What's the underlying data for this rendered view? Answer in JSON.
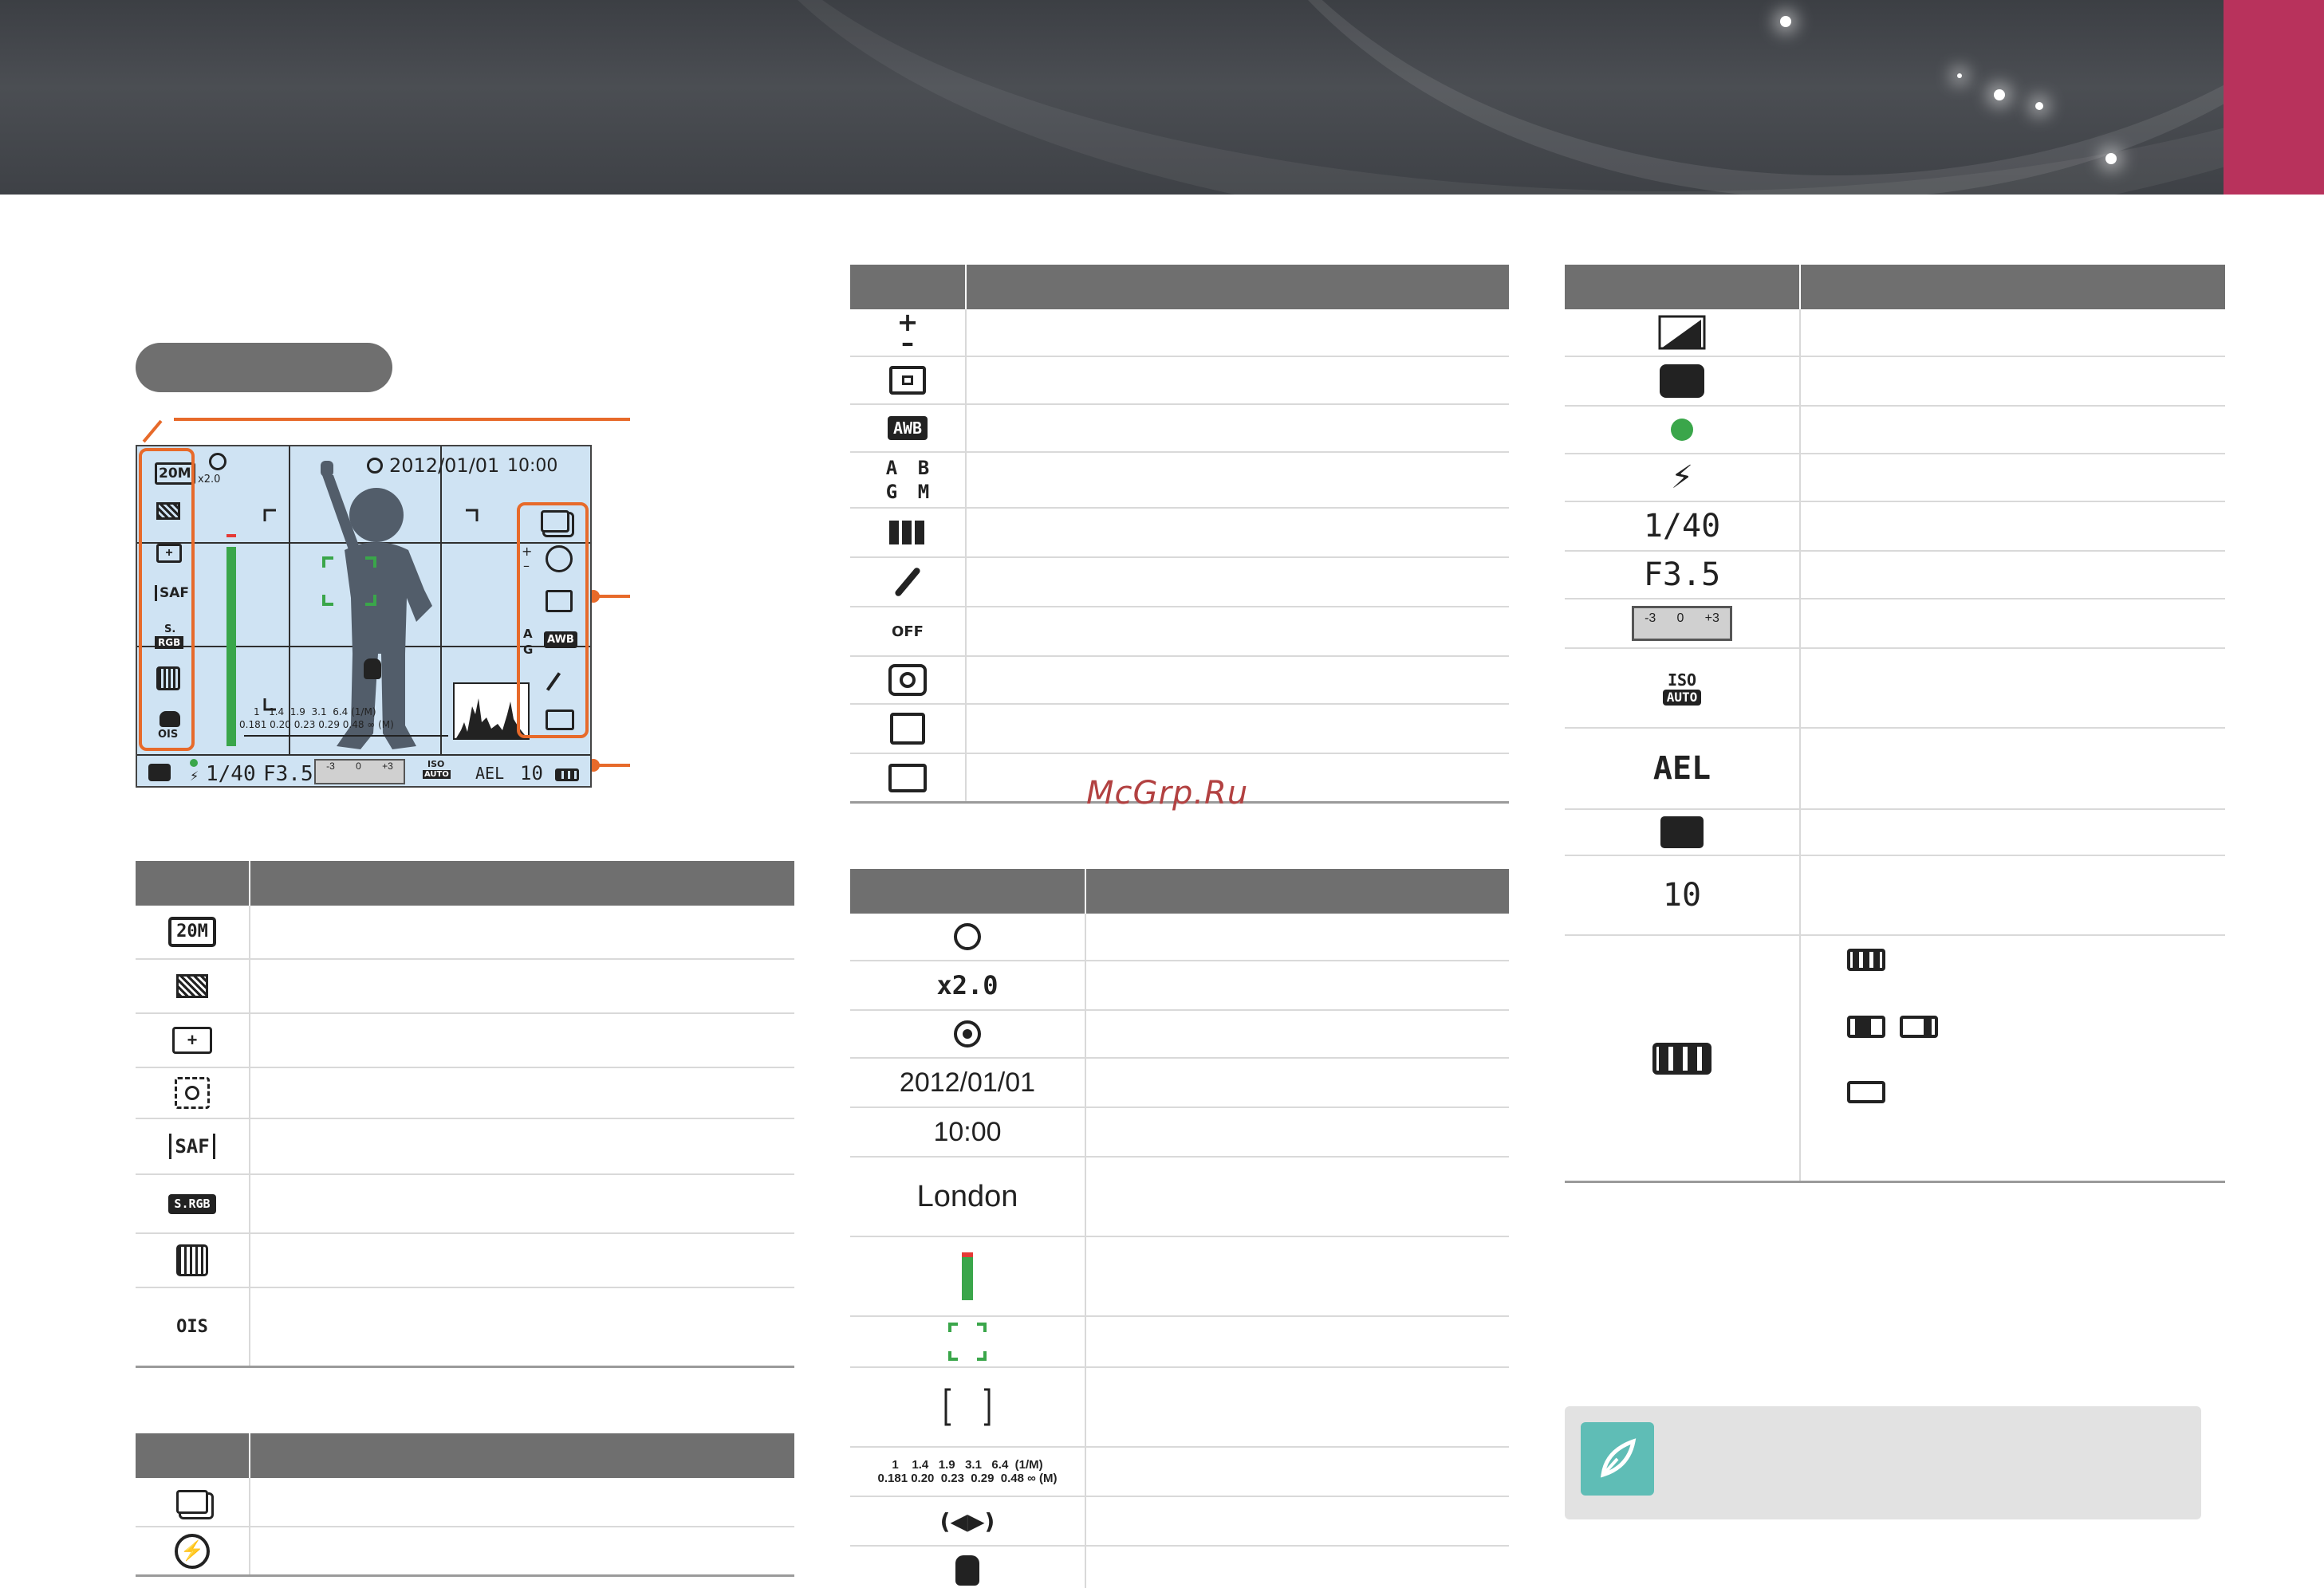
{
  "watermark": "McGrp.Ru",
  "table_left1": {
    "icons": [
      "20M",
      "quality-icon",
      "spot-af-icon",
      "face-af-icon",
      "SAF",
      "S.RGB",
      "smart-filter-off-icon",
      "OIS"
    ]
  },
  "table_left2": {
    "icons": [
      "drive-single-icon",
      "flash-off-icon"
    ]
  },
  "table_mid1": {
    "icons": [
      "exposure-comp-icon",
      "metering-icon",
      "AWB",
      "A B G M",
      "picture-wizard-icon",
      "smart-filter-icon",
      "color-off-icon",
      "iFunction-icon",
      "face-detect-icon",
      "smart-range-icon"
    ],
    "wb_shift": [
      "A",
      "B",
      "G",
      "M"
    ],
    "awb": "AWB",
    "color_off": "OFF"
  },
  "table_mid2": {
    "zoom": "x2.0",
    "date": "2012/01/01",
    "time": "10:00",
    "city": "London",
    "distance_top": "1    1.4   1.9   3.1   6.4  (1/M)",
    "distance_bottom": "0.181 0.20  0.23  0.29  0.48 ∞ (M)"
  },
  "table_right": {
    "shutter": "1/40",
    "aperture": "F3.5",
    "ev_scale": [
      "-3",
      "0",
      "+3"
    ],
    "iso_top": "ISO",
    "iso_bottom": "AUTO",
    "ael": "AEL",
    "shots": "10"
  },
  "screen": {
    "zoom_label": "x2.0",
    "date": "2012/01/01",
    "time": "10:00",
    "shutter": "1/40",
    "aperture": "F3.5",
    "ev": [
      "-3",
      "0",
      "+3"
    ],
    "iso_top": "ISO",
    "iso_bottom": "AUTO",
    "ael": "AEL",
    "shots": "10",
    "res": "20M",
    "saf": "SAF",
    "srgb_top": "S.",
    "srgb_bottom": "RGB",
    "ois": "OIS",
    "awb": "AWB",
    "wb_a": "A",
    "wb_g": "G",
    "dist_top": "1   1.4  1.9  3.1  6.4 (1/M)",
    "dist_bottom": "0.181 0.20 0.23 0.29 0.48 ∞ (M)"
  },
  "colors": {
    "header_gray": "#6f6f6f",
    "accent_pink": "#b8325c",
    "callout_orange": "#e76a2a",
    "focus_green": "#3aa64a",
    "note_teal": "#5fbdb6"
  }
}
